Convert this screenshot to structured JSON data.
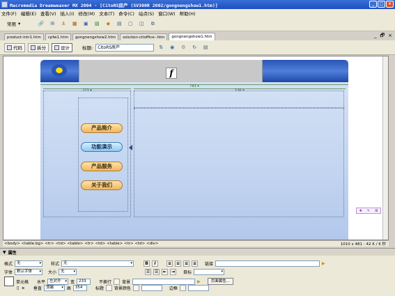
{
  "window": {
    "title": "Macromedia Dreamweaver MX 2004 - [CitoRS房产 (SV300R 2002/gongnengshow1.htm)]",
    "min": "_",
    "max": "□",
    "close": "×"
  },
  "menu": [
    "文件(F)",
    "编辑(E)",
    "查看(V)",
    "插入(I)",
    "修改(M)",
    "文本(T)",
    "命令(C)",
    "站点(S)",
    "窗口(W)",
    "帮助(H)"
  ],
  "toolbar": {
    "category": "常用"
  },
  "doc_tabs": [
    "product-intr1.htm",
    "cpfw1.htm",
    "gongnengshow2.htm",
    "solution-citoffice-.htm",
    "gongnengshow1.htm"
  ],
  "doc_ctrls": {
    "minimize": "_",
    "restore": "🗗",
    "close": "×"
  },
  "view_buttons": {
    "code": "代码",
    "split": "拆分",
    "design": "设计"
  },
  "title_field": {
    "label": "标题:",
    "value": "CitoRS房产"
  },
  "canvas": {
    "ruler_total": "783 ▾",
    "ruler_left": "233 ▾",
    "ruler_right": "536 ▾",
    "flash_glyph": "f",
    "nav": [
      "产品简介",
      "功能演示",
      "产品服务",
      "关于我们"
    ],
    "active_nav_index": 1
  },
  "side_float": {
    "a": "✚",
    "b": "✎",
    "c": "⊠"
  },
  "status": {
    "tag_path": "<body> <table.bg> <tr> <td> <table> <tr> <td> <table> <tr> <td> <div>",
    "size": "1010 x 481 - 42 K / 6 秒"
  },
  "properties": {
    "title": "属性",
    "format_label": "格式",
    "format_value": "无",
    "style_label": "样式",
    "style_value": "无",
    "font_label": "字体",
    "font_value": "默认字体",
    "size_label": "大小",
    "size_value": "无",
    "link_label": "链接",
    "target_label": "目标",
    "cell_label": "单元格",
    "horiz_label": "水平",
    "horiz_value": "左对齐",
    "vert_label": "垂直",
    "vert_value": "顶端",
    "width_label": "宽",
    "width_value": "233",
    "height_label": "高",
    "height_value": "354",
    "nowrap_label": "不换行",
    "header_label": "标题",
    "bg_label": "背景",
    "bgcolor_label": "背景颜色",
    "border_label": "边框",
    "page_props_button": "页面属性...",
    "bold": "B",
    "italic": "I"
  }
}
